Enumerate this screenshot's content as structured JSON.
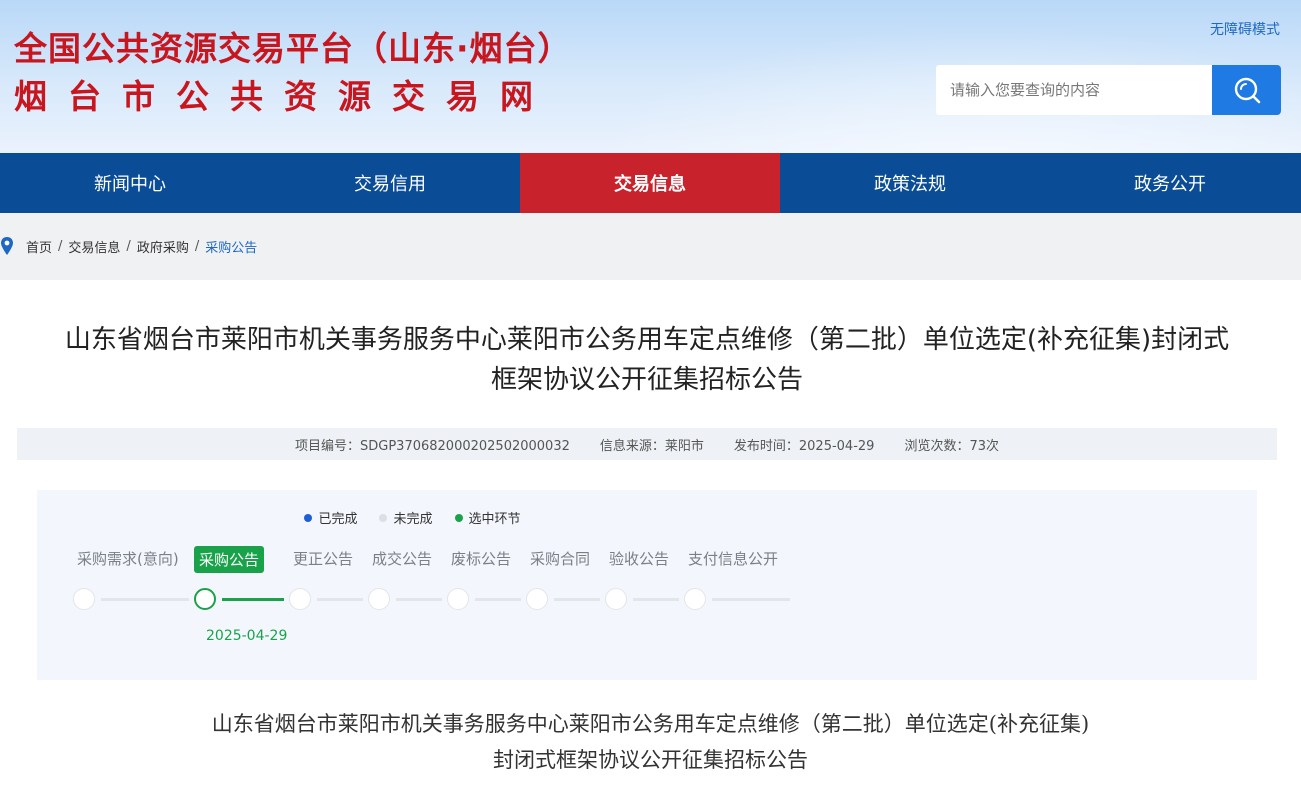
{
  "header": {
    "title_line1": "全国公共资源交易平台（山东·烟台）",
    "title_line2": "烟台市公共资源交易网",
    "accessibility_link": "无障碍模式",
    "search_placeholder": "请输入您要查询的内容",
    "search_icon": "search-icon"
  },
  "nav": {
    "items": [
      {
        "label": "新闻中心"
      },
      {
        "label": "交易信用"
      },
      {
        "label": "交易信息"
      },
      {
        "label": "政策法规"
      },
      {
        "label": "政务公开"
      }
    ],
    "active_index": 2,
    "colors": {
      "bar": "#0a4d96",
      "active": "#c8232c"
    }
  },
  "breadcrumb": {
    "items": [
      "首页",
      "交易信息",
      "政府采购",
      "采购公告"
    ],
    "icon": "location-pin-icon"
  },
  "article": {
    "title_line1": "山东省烟台市莱阳市机关事务服务中心莱阳市公务用车定点维修（第二批）单位选定(补充征集)封闭式",
    "title_line2": "框架协议公开征集招标公告",
    "meta": {
      "project_no": "项目编号：SDGP370682000202502000032",
      "source": "信息来源：莱阳市",
      "publish_time": "发布时间：2025-04-29",
      "views": "浏览次数：73次"
    }
  },
  "flow": {
    "legend": [
      {
        "label": "已完成",
        "color": "#1e5fd6"
      },
      {
        "label": "未完成",
        "color": "#dcdfe4"
      },
      {
        "label": "选中环节",
        "color": "#1aa24b"
      }
    ],
    "steps": [
      {
        "label": "采购需求(意向)"
      },
      {
        "label": "采购公告",
        "date": "2025-04-29"
      },
      {
        "label": "更正公告"
      },
      {
        "label": "成交公告"
      },
      {
        "label": "废标公告"
      },
      {
        "label": "采购合同"
      },
      {
        "label": "验收公告"
      },
      {
        "label": "支付信息公开"
      }
    ],
    "active_index": 1,
    "active_color": "#1aa24b"
  },
  "body": {
    "title_line1": "山东省烟台市莱阳市机关事务服务中心莱阳市公务用车定点维修（第二批）单位选定(补充征集)",
    "title_line2": "封闭式框架协议公开征集招标公告"
  }
}
